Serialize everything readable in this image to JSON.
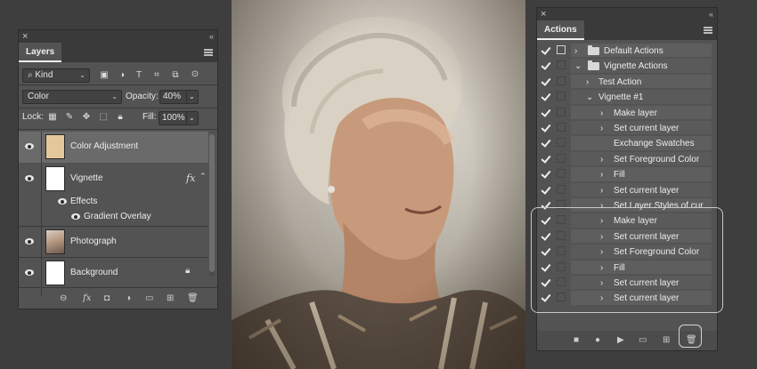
{
  "layers_panel": {
    "tab_label": "Layers",
    "filter_label": "Kind",
    "blend_mode": "Color",
    "opacity_label": "Opacity:",
    "opacity_value": "40%",
    "lock_label": "Lock:",
    "fill_label": "Fill:",
    "fill_value": "100%",
    "layers": [
      {
        "name": "Color Adjustment",
        "selected": true,
        "thumb_color": "#e4c89b"
      },
      {
        "name": "Vignette",
        "effects_label": "Effects",
        "effect_name": "Gradient Overlay",
        "fx": "fx"
      },
      {
        "name": "Photograph"
      },
      {
        "name": "Background"
      }
    ]
  },
  "actions_panel": {
    "tab_label": "Actions",
    "rows": [
      {
        "label": "Default Actions",
        "kind": "set"
      },
      {
        "label": "Vignette Actions",
        "kind": "set"
      },
      {
        "label": "Test Action",
        "kind": "action"
      },
      {
        "label": "Vignette #1",
        "kind": "action"
      },
      {
        "label": "Make layer",
        "kind": "step"
      },
      {
        "label": "Set current layer",
        "kind": "step"
      },
      {
        "label": "Exchange Swatches",
        "kind": "step"
      },
      {
        "label": "Set Foreground Color",
        "kind": "step"
      },
      {
        "label": "Fill",
        "kind": "step"
      },
      {
        "label": "Set current layer",
        "kind": "step"
      },
      {
        "label": "Set Layer Styles of cur",
        "kind": "step"
      },
      {
        "label": "Make layer",
        "kind": "step"
      },
      {
        "label": "Set current layer",
        "kind": "step"
      },
      {
        "label": "Set Foreground Color",
        "kind": "step"
      },
      {
        "label": "Fill",
        "kind": "step"
      },
      {
        "label": "Set current layer",
        "kind": "step"
      },
      {
        "label": "Set current layer",
        "kind": "step"
      }
    ]
  },
  "photo": {
    "subject": "portrait-photo"
  }
}
